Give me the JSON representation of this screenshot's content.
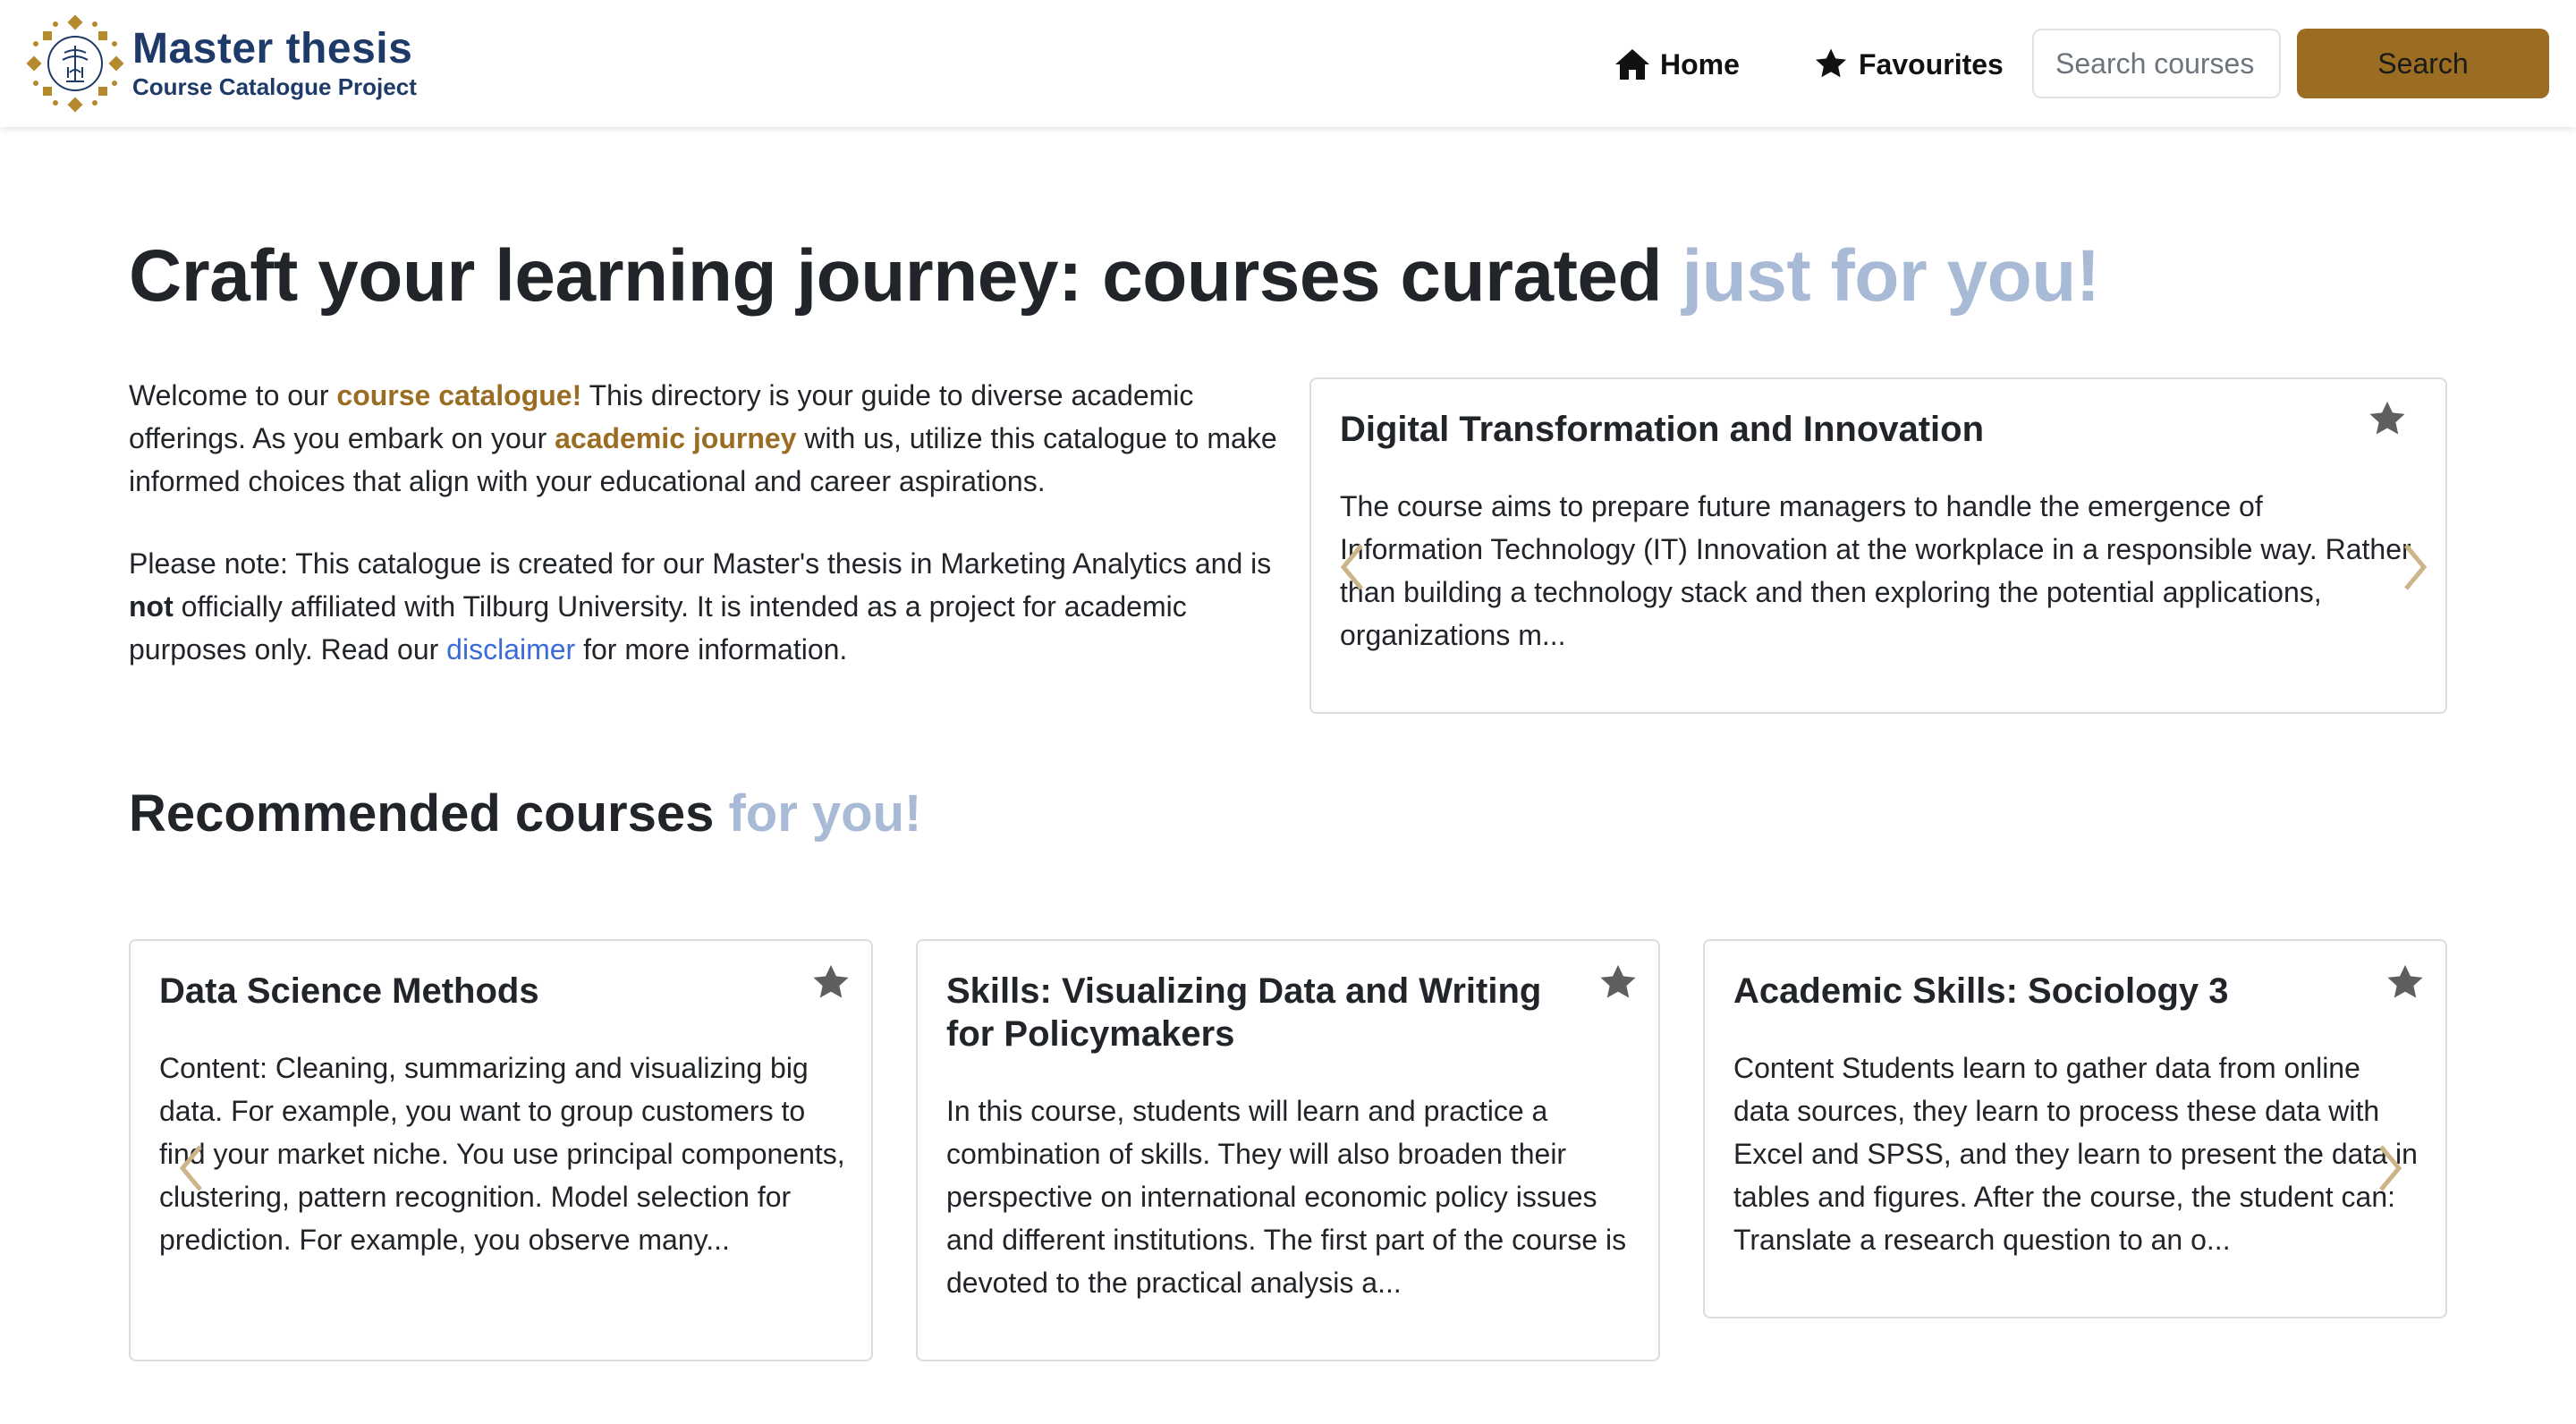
{
  "brand": {
    "title": "Master thesis",
    "subtitle": "Course Catalogue Project",
    "logo_icon": "university-seal-icon"
  },
  "nav": {
    "home_label": "Home",
    "favourites_label": "Favourites",
    "search_placeholder": "Search courses",
    "search_button": "Search"
  },
  "hero": {
    "title_main": "Craft your learning journey: courses curated ",
    "title_accent": "just for you!"
  },
  "intro": {
    "p1_a": "Welcome to our ",
    "p1_b": "course catalogue!",
    "p1_c": " This directory is your guide to diverse academic offerings. As you embark on your ",
    "p1_d": "academic journey",
    "p1_e": " with us, utilize this catalogue to make informed choices that align with your educational and career aspirations.",
    "p2_a": "Please note: This catalogue is created for our Master's thesis in Marketing Analytics and is ",
    "p2_b": "not",
    "p2_c": " officially affiliated with Tilburg University. It is intended as a project for academic purposes only. Read our ",
    "p2_link": "disclaimer",
    "p2_d": " for more information."
  },
  "featured": {
    "title": "Digital Transformation and Innovation",
    "text": "The course aims to prepare future managers to handle the emergence of Information Technology (IT) Innovation at the workplace in a responsible way. Rather than building a technology stack and then exploring the potential applications, organizations m..."
  },
  "recommended": {
    "title_main": "Recommended courses ",
    "title_accent": "for you!",
    "cards": [
      {
        "title": "Data Science Methods",
        "text": "Content: Cleaning, summarizing and visualizing big data. For example, you want to group customers to find your market niche. You use principal components, clustering, pattern recognition. Model selection for prediction. For example, you observe many..."
      },
      {
        "title": "Skills: Visualizing Data and Writing for Policymakers",
        "text": "In this course, students will learn and practice a combination of skills. They will also broaden their perspective on international economic policy issues and different institutions. The first part of the course is devoted to the practical analysis a..."
      },
      {
        "title": "Academic Skills: Sociology 3",
        "text": "Content Students learn to gather data from online data sources, they learn to process these data with Excel and SPSS, and they learn to present the data in tables and figures. After the course, the student can: Translate a research question to an o..."
      }
    ]
  },
  "colors": {
    "brand_navy": "#1d3a68",
    "gold": "#9a6d23",
    "accent_light": "#a8bad6",
    "link_blue": "#3b6bd8"
  }
}
